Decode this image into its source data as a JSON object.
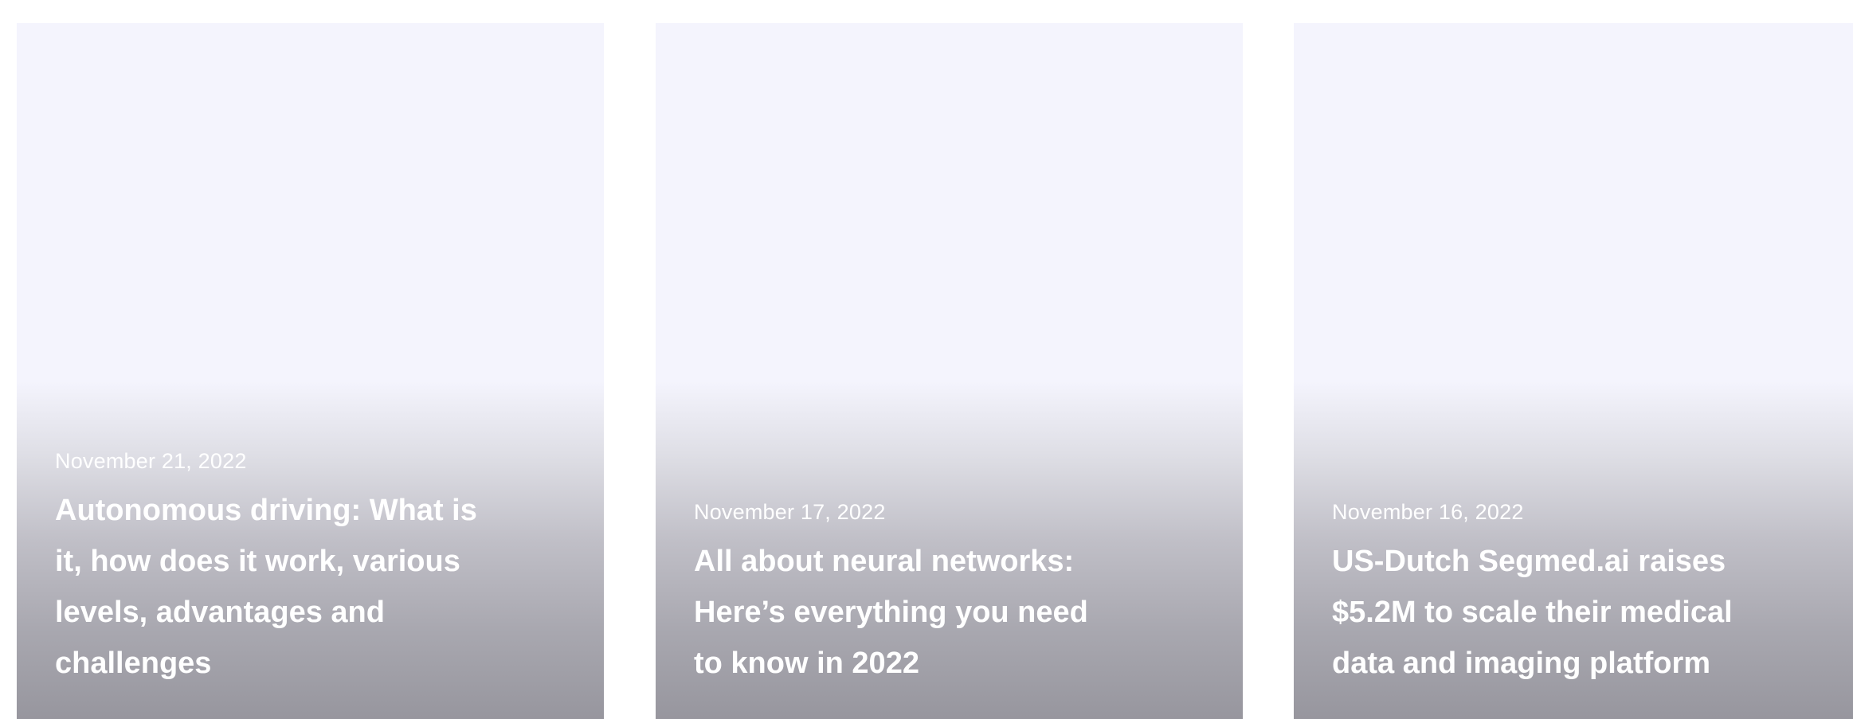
{
  "cards": [
    {
      "date": "November 21, 2022",
      "title": "Autonomous driving: What is it, how does it work, various levels, advantages and challenges"
    },
    {
      "date": "November 17, 2022",
      "title": "All about neural networks: Here’s everything you need to know in 2022"
    },
    {
      "date": "November 16, 2022",
      "title": "US-Dutch Segmed.ai raises $5.2M to scale their medical data and imaging platform"
    }
  ],
  "colors": {
    "card_top": "#f4f4fd",
    "card_bottom": "#97969e",
    "text": "#ffffff"
  }
}
